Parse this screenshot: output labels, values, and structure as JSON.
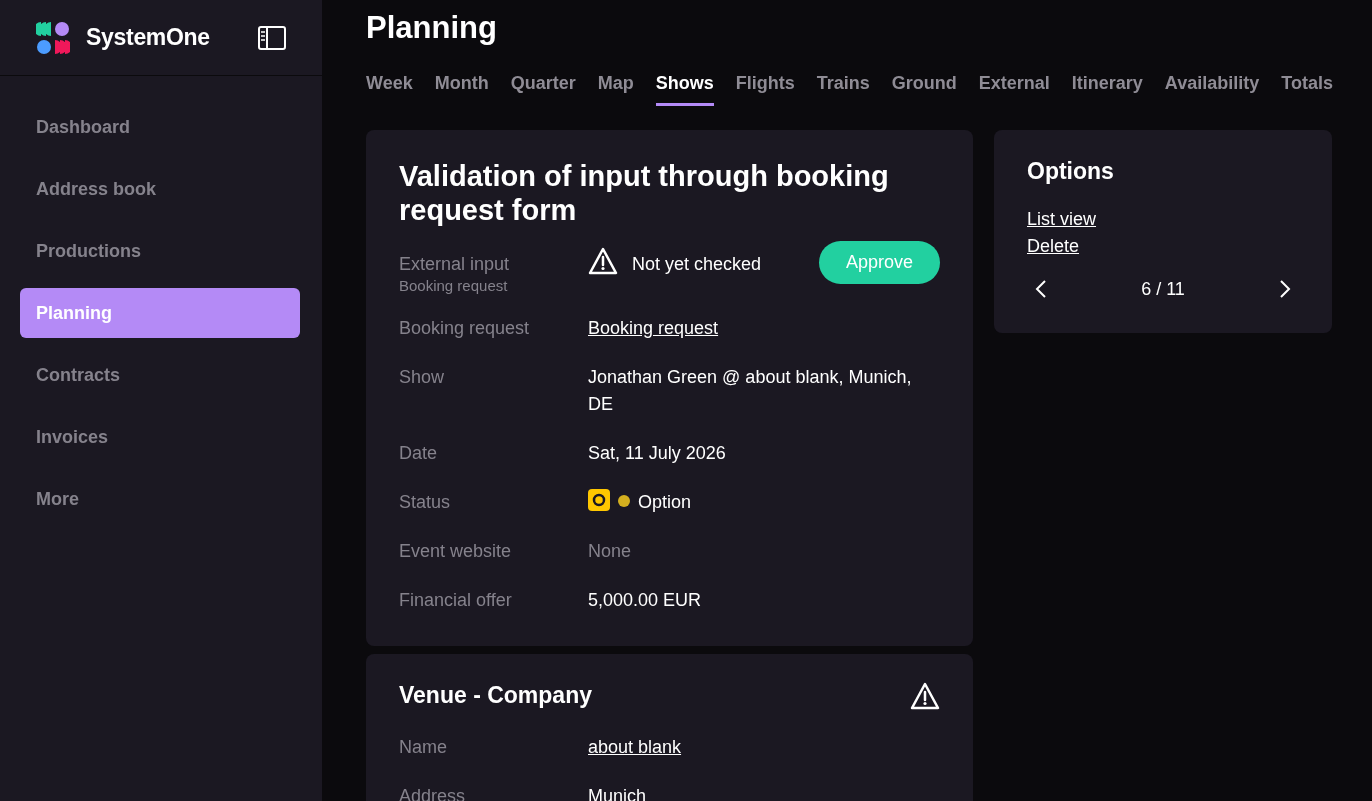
{
  "brand": {
    "name": "SystemOne"
  },
  "sidebar": {
    "items": [
      {
        "label": "Dashboard",
        "selected": false
      },
      {
        "label": "Address book",
        "selected": false
      },
      {
        "label": "Productions",
        "selected": false
      },
      {
        "label": "Planning",
        "selected": true
      },
      {
        "label": "Contracts",
        "selected": false
      },
      {
        "label": "Invoices",
        "selected": false
      },
      {
        "label": "More",
        "selected": false
      }
    ]
  },
  "page": {
    "title": "Planning"
  },
  "tabs": [
    {
      "label": "Week",
      "selected": false
    },
    {
      "label": "Month",
      "selected": false
    },
    {
      "label": "Quarter",
      "selected": false
    },
    {
      "label": "Map",
      "selected": false
    },
    {
      "label": "Shows",
      "selected": true
    },
    {
      "label": "Flights",
      "selected": false
    },
    {
      "label": "Trains",
      "selected": false
    },
    {
      "label": "Ground",
      "selected": false
    },
    {
      "label": "External",
      "selected": false
    },
    {
      "label": "Itinerary",
      "selected": false
    },
    {
      "label": "Availability",
      "selected": false
    },
    {
      "label": "Totals",
      "selected": false
    }
  ],
  "request_card": {
    "title": "Validation of input through booking request form",
    "rows": [
      {
        "kind": "check",
        "label": "External input",
        "sublabel": "Booking request",
        "value": "Not yet checked",
        "button": "Approve"
      },
      {
        "kind": "link",
        "label": "Booking request",
        "value": "Booking request"
      },
      {
        "kind": "text",
        "label": "Show",
        "value": "Jonathan Green @ about blank, Munich, DE"
      },
      {
        "kind": "text",
        "label": "Date",
        "value": "Sat, 11 July 2026"
      },
      {
        "kind": "status",
        "label": "Status",
        "value": "Option",
        "color": "#d4af1f"
      },
      {
        "kind": "muted",
        "label": "Event website",
        "value": "None"
      },
      {
        "kind": "text",
        "label": "Financial offer",
        "value": "5,000.00 EUR"
      }
    ]
  },
  "venue_card": {
    "title": "Venue - Company",
    "rows": [
      {
        "kind": "link",
        "label": "Name",
        "value": "about blank"
      },
      {
        "kind": "text",
        "label": "Address",
        "value": "Munich"
      }
    ]
  },
  "options": {
    "title": "Options",
    "links": [
      "List view",
      "Delete"
    ],
    "pager": "6 / 11"
  }
}
